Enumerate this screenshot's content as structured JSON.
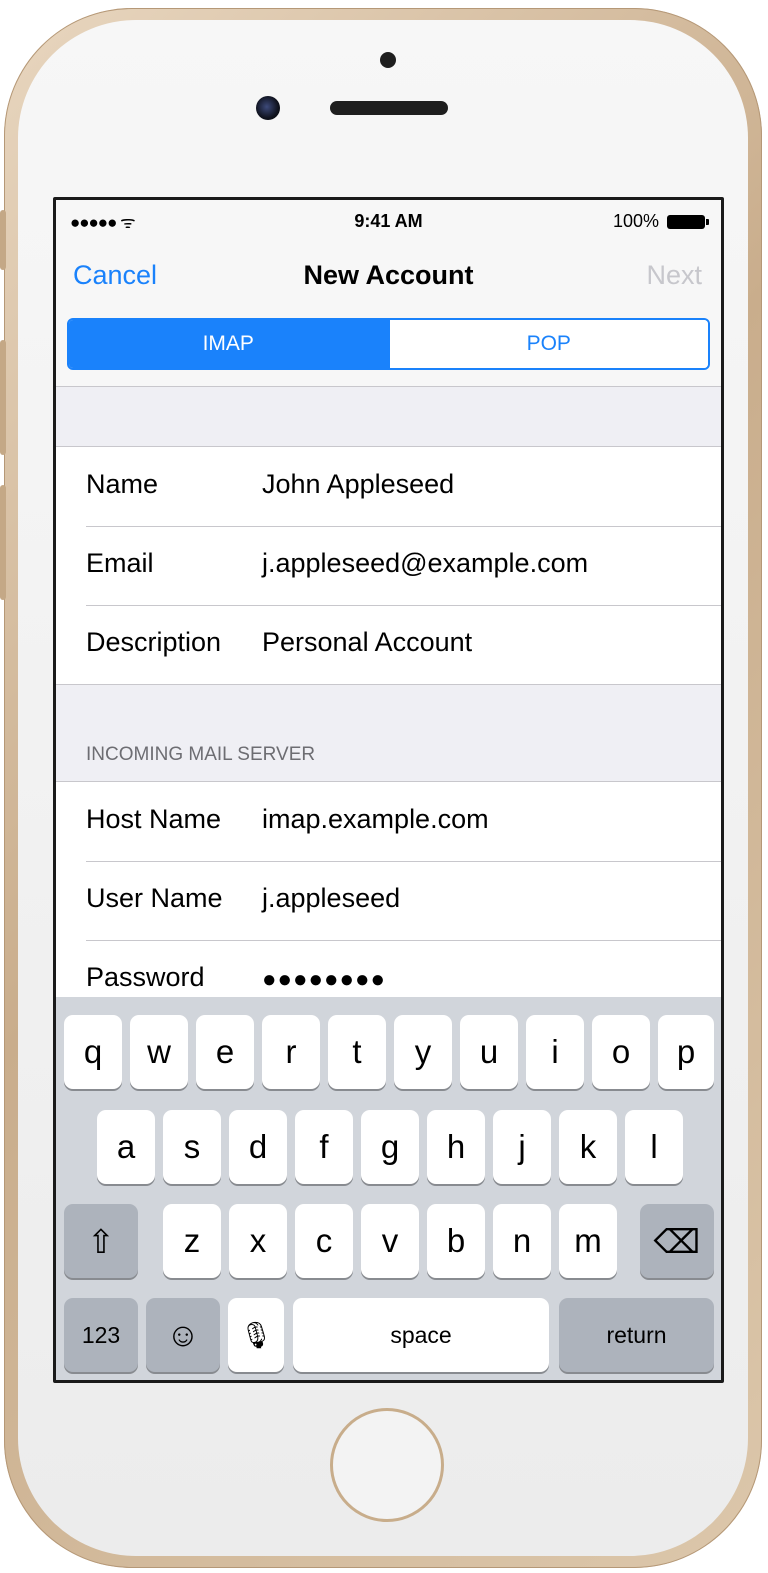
{
  "status_bar": {
    "signal": "●●●●● ᯤ",
    "time": "9:41 AM",
    "battery_text": "100%",
    "battery_level": 1.0
  },
  "nav": {
    "cancel": "Cancel",
    "title": "New Account",
    "next": "Next"
  },
  "segment": {
    "options": [
      "IMAP",
      "POP"
    ],
    "selected": "IMAP"
  },
  "account_fields": [
    {
      "label": "Name",
      "value": "John Appleseed"
    },
    {
      "label": "Email",
      "value": "j.appleseed@example.com"
    },
    {
      "label": "Description",
      "value": "Personal Account"
    }
  ],
  "incoming_section": {
    "header": "INCOMING MAIL SERVER",
    "fields": [
      {
        "label": "Host Name",
        "value": "imap.example.com"
      },
      {
        "label": "User Name",
        "value": "j.appleseed"
      },
      {
        "label": "Password",
        "value": "●●●●●●●●"
      }
    ]
  },
  "keyboard": {
    "row1": [
      "q",
      "w",
      "e",
      "r",
      "t",
      "y",
      "u",
      "i",
      "o",
      "p"
    ],
    "row2": [
      "a",
      "s",
      "d",
      "f",
      "g",
      "h",
      "j",
      "k",
      "l"
    ],
    "row3": [
      "z",
      "x",
      "c",
      "v",
      "b",
      "n",
      "m"
    ],
    "shift_icon": "⇧",
    "delete_icon": "⌫",
    "numbers": "123",
    "emoji_icon": "☺",
    "mic_icon": "🎙",
    "space": "space",
    "return": "return"
  },
  "colors": {
    "accent": "#1a82fb",
    "disabled": "#c7c7cc",
    "group_bg": "#efeff4",
    "keyboard_bg": "#d1d5db"
  }
}
